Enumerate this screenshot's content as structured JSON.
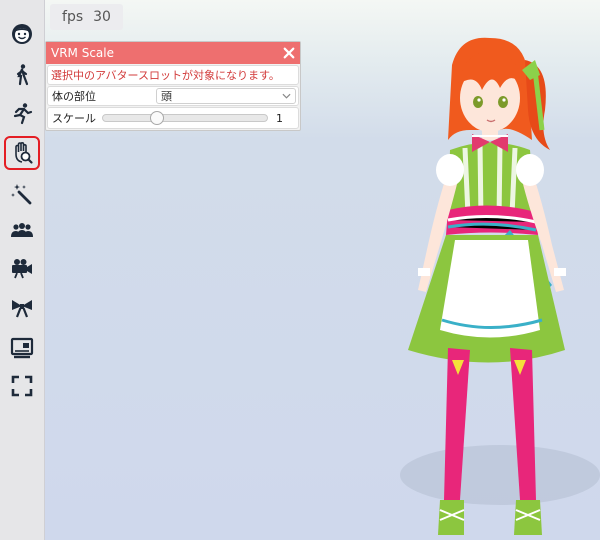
{
  "fps": {
    "label": "fps",
    "value": "30"
  },
  "sidebar": {
    "items": [
      {
        "icon": "face-icon"
      },
      {
        "icon": "walking-person-icon"
      },
      {
        "icon": "running-person-icon"
      },
      {
        "icon": "hand-search-icon",
        "highlighted": true
      },
      {
        "icon": "magic-wand-icon"
      },
      {
        "icon": "group-people-icon"
      },
      {
        "icon": "video-camera-icon"
      },
      {
        "icon": "bow-ribbon-icon"
      },
      {
        "icon": "display-screen-icon"
      },
      {
        "icon": "fullscreen-icon"
      }
    ]
  },
  "panel": {
    "title": "VRM Scale",
    "message": "選択中のアバタースロットが対象になります。",
    "body_part_label": "体の部位",
    "body_part_value": "頭",
    "scale_label": "スケール",
    "scale_value": "1",
    "scale_fraction": 0.33
  },
  "colors": {
    "header": "#ee6f6f",
    "message_text": "#d23b3b",
    "highlight_border": "#e41e24",
    "hair": "#f05a1e",
    "dress_green": "#8cc63f",
    "stockings": "#e8267a"
  }
}
